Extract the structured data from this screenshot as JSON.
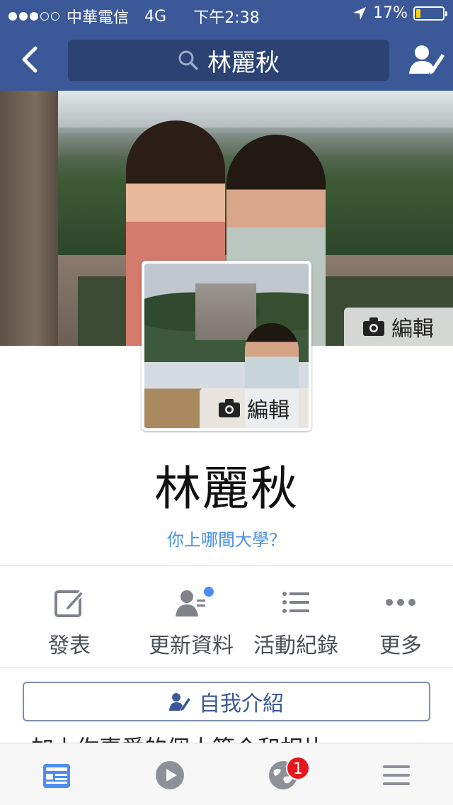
{
  "status_bar": {
    "carrier": "中華電信",
    "network": "4G",
    "time": "下午2:38",
    "battery": "17%",
    "battery_level": 0.17,
    "signal_bars_filled": 3,
    "signal_bars_total": 5
  },
  "nav": {
    "search_text": "林麗秋",
    "back_icon": "chevron-left-icon",
    "search_icon": "search-icon",
    "edit_profile_icon": "user-edit-icon"
  },
  "cover": {
    "edit_label": "編輯",
    "edit_icon": "camera-icon"
  },
  "profile_photo": {
    "edit_label": "編輯",
    "edit_icon": "camera-icon"
  },
  "profile": {
    "name": "林麗秋",
    "education_prompt": "你上哪間大學？"
  },
  "actions": [
    {
      "label": "發表",
      "icon": "compose-icon"
    },
    {
      "label": "更新資料",
      "icon": "update-info-icon",
      "has_dot": true
    },
    {
      "label": "活動紀錄",
      "icon": "list-icon"
    },
    {
      "label": "更多",
      "icon": "more-icon"
    }
  ],
  "about": {
    "label": "自我介紹",
    "icon": "user-edit-icon"
  },
  "partial_text": "加上你喜愛的個人簡介和相片",
  "tab_bar": {
    "tabs": [
      {
        "name": "news-feed",
        "icon": "news-feed-icon",
        "active": true
      },
      {
        "name": "video",
        "icon": "play-icon"
      },
      {
        "name": "notifications",
        "icon": "globe-icon",
        "badge": "1"
      },
      {
        "name": "menu",
        "icon": "hamburger-icon"
      }
    ]
  },
  "colors": {
    "brand": "#3b5998",
    "link": "#4a90e2",
    "badge": "#e8151b",
    "battery": "#ffd60a"
  }
}
